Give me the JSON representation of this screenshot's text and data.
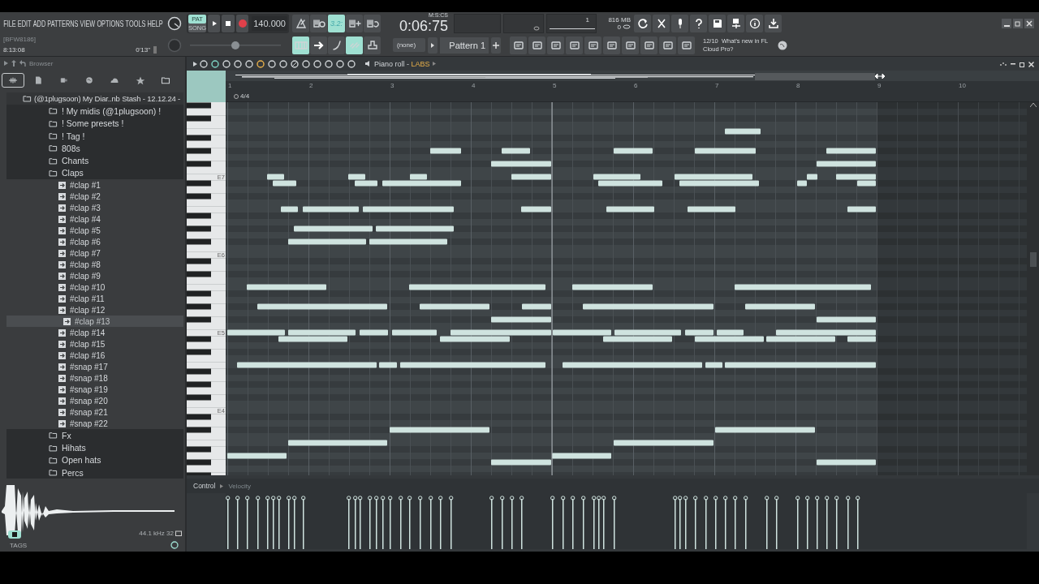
{
  "menu": [
    "FILE",
    "EDIT",
    "ADD",
    "PATTERNS",
    "VIEW",
    "OPTIONS",
    "TOOLS",
    "HELP"
  ],
  "hint": {
    "code": "[BFW8186]",
    "value": "8:13:08",
    "duration": "0'13\""
  },
  "transport": {
    "modes": [
      {
        "label": "PAT",
        "selected": true
      },
      {
        "label": "SONG",
        "selected": false
      }
    ],
    "tempo": "140.000"
  },
  "record_toggles": [
    {
      "kind": "metronome",
      "on": false
    },
    {
      "kind": "wait",
      "on": false
    },
    {
      "kind": "countdown",
      "label": "3.2:",
      "on": true
    },
    {
      "kind": "blend",
      "on": false
    },
    {
      "kind": "loop",
      "on": false
    }
  ],
  "clock": {
    "time": "0:06:75",
    "unit": "M:S:CS"
  },
  "monitor": {
    "voices": "1",
    "memory": "816 MB",
    "polyphony": "0"
  },
  "pitch_slider": {
    "level": 0.5
  },
  "snap_toggles": [
    {
      "kind": "keys",
      "on": true
    },
    {
      "kind": "arrow",
      "on": false
    },
    {
      "kind": "curve",
      "on": false
    },
    {
      "kind": "link",
      "on": true
    },
    {
      "kind": "stamp",
      "on": false
    }
  ],
  "pattern": {
    "preset": "(none)",
    "name": "Pattern 1"
  },
  "news": {
    "date": "12/10",
    "text": "What's new in FL Cloud Pro?"
  },
  "browser": {
    "title": "Browser",
    "tabs": [
      {
        "kind": "all",
        "selected": true
      },
      {
        "kind": "file",
        "selected": false
      },
      {
        "kind": "plugin",
        "selected": false
      },
      {
        "kind": "web",
        "selected": false
      },
      {
        "kind": "cloud",
        "selected": false
      },
      {
        "kind": "star",
        "selected": false
      },
      {
        "kind": "folder",
        "selected": false
      }
    ],
    "tree": [
      {
        "label": "(@1plugsoon) My Diar..nb Stash - 12.12.24 -",
        "kind": "folder",
        "selected": false,
        "children": [
          {
            "label": "! My midis (@1plugsoon) !",
            "kind": "folder",
            "selected": false
          },
          {
            "label": "! Some presets !",
            "kind": "folder",
            "selected": false
          },
          {
            "label": "! Tag !",
            "kind": "folder",
            "selected": false
          },
          {
            "label": "808s",
            "kind": "folder",
            "selected": false
          },
          {
            "label": "Chants",
            "kind": "folder",
            "selected": false
          },
          {
            "label": "Claps",
            "kind": "folder",
            "selected": false,
            "children": [
              {
                "label": "#clap #1",
                "kind": "file",
                "selected": false
              },
              {
                "label": "#clap #2",
                "kind": "file",
                "selected": false
              },
              {
                "label": "#clap #3",
                "kind": "file",
                "selected": false
              },
              {
                "label": "#clap #4",
                "kind": "file",
                "selected": false
              },
              {
                "label": "#clap #5",
                "kind": "file",
                "selected": false
              },
              {
                "label": "#clap #6",
                "kind": "file",
                "selected": false
              },
              {
                "label": "#clap #7",
                "kind": "file",
                "selected": false
              },
              {
                "label": "#clap #8",
                "kind": "file",
                "selected": false
              },
              {
                "label": "#clap #9",
                "kind": "file",
                "selected": false
              },
              {
                "label": "#clap #10",
                "kind": "file",
                "selected": false
              },
              {
                "label": "#clap #11",
                "kind": "file",
                "selected": false
              },
              {
                "label": "#clap #12",
                "kind": "file",
                "selected": false
              },
              {
                "label": "#clap #13",
                "kind": "file",
                "selected": true
              },
              {
                "label": "#clap #14",
                "kind": "file",
                "selected": false
              },
              {
                "label": "#clap #15",
                "kind": "file",
                "selected": false
              },
              {
                "label": "#clap #16",
                "kind": "file",
                "selected": false
              },
              {
                "label": "#snap #17",
                "kind": "file",
                "selected": false
              },
              {
                "label": "#snap #18",
                "kind": "file",
                "selected": false
              },
              {
                "label": "#snap #19",
                "kind": "file",
                "selected": false
              },
              {
                "label": "#snap #20",
                "kind": "file",
                "selected": false
              },
              {
                "label": "#snap #21",
                "kind": "file",
                "selected": false
              },
              {
                "label": "#snap #22",
                "kind": "file",
                "selected": false
              }
            ]
          },
          {
            "label": "Fx",
            "kind": "folder",
            "selected": false
          },
          {
            "label": "Hihats",
            "kind": "folder",
            "selected": false
          },
          {
            "label": "Open hats",
            "kind": "folder",
            "selected": false
          },
          {
            "label": "Percs",
            "kind": "folder",
            "selected": false
          }
        ]
      }
    ],
    "sample_info": "44.1 kHz 32",
    "tags": "TAGS"
  },
  "piano_roll": {
    "title": "Piano roll -",
    "instrument": "LABS",
    "bars": [
      "1",
      "2",
      "3",
      "4",
      "5",
      "6",
      "7",
      "8",
      "9",
      "10"
    ],
    "time_signature": "4/4",
    "octaves": [
      "E7",
      "E6",
      "E5",
      "E4"
    ],
    "control": "Control",
    "control_target": "Velocity"
  }
}
